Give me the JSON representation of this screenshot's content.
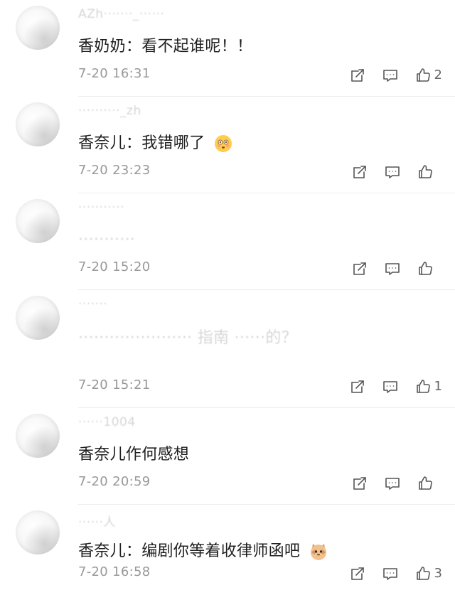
{
  "comments": [
    {
      "username": "AZh·······_······",
      "text": "香奶奶：看不起谁呢！！",
      "time": "7-20 16:31",
      "likes": "2",
      "emoji": ""
    },
    {
      "username": "··········_zh",
      "text": "香奈儿：我错哪了",
      "time": "7-20 23:23",
      "likes": "",
      "emoji": "flushed-face"
    },
    {
      "username": "···········",
      "text": "···········",
      "time": "7-20 15:20",
      "likes": "",
      "emoji": ""
    },
    {
      "username": "·······",
      "text": "······················ 指南 ······的？",
      "time": "7-20 15:21",
      "likes": "1",
      "emoji": ""
    },
    {
      "username": "······1004",
      "text": "香奈儿作何感想",
      "time": "7-20 20:59",
      "likes": "",
      "emoji": ""
    },
    {
      "username": "······人",
      "text": "香奈儿：编剧你等着收律师函吧",
      "time": "7-20 16:58",
      "likes": "3",
      "emoji": "cat-face"
    }
  ]
}
